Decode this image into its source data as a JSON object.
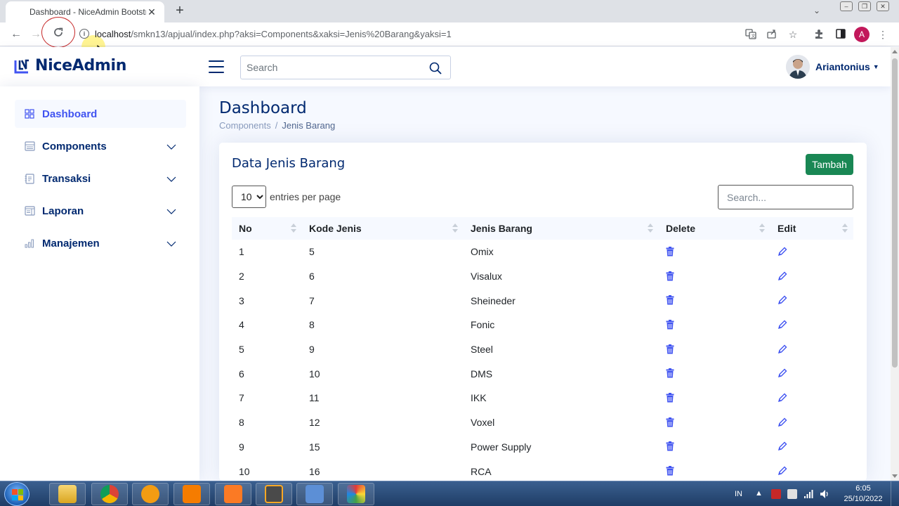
{
  "browser": {
    "tab_title": "Dashboard - NiceAdmin Bootstra",
    "url_host": "localhost",
    "url_path": "/smkn13/apjual/index.php?aksi=Components&xaksi=Jenis%20Barang&yaksi=1",
    "profile_initial": "A"
  },
  "header": {
    "logo": "NiceAdmin",
    "search_placeholder": "Search",
    "user_name": "Ariantonius"
  },
  "sidebar": {
    "items": [
      {
        "label": "Dashboard",
        "icon": "grid-icon",
        "active": true
      },
      {
        "label": "Components",
        "icon": "menu-button-icon"
      },
      {
        "label": "Transaksi",
        "icon": "journal-text-icon"
      },
      {
        "label": "Laporan",
        "icon": "layout-text-window-icon"
      },
      {
        "label": "Manajemen",
        "icon": "bar-chart-icon"
      }
    ]
  },
  "page": {
    "title": "Dashboard",
    "breadcrumb": [
      "Components",
      "Jenis Barang"
    ]
  },
  "card": {
    "title": "Data Jenis Barang",
    "add_button": "Tambah",
    "per_page_value": "10",
    "per_page_label": "entries per page",
    "search_placeholder": "Search...",
    "columns": [
      "No",
      "Kode Jenis",
      "Jenis Barang",
      "Delete",
      "Edit"
    ],
    "rows": [
      {
        "no": "1",
        "kode": "5",
        "jenis": "Omix"
      },
      {
        "no": "2",
        "kode": "6",
        "jenis": "Visalux"
      },
      {
        "no": "3",
        "kode": "7",
        "jenis": "Sheineder"
      },
      {
        "no": "4",
        "kode": "8",
        "jenis": "Fonic"
      },
      {
        "no": "5",
        "kode": "9",
        "jenis": "Steel"
      },
      {
        "no": "6",
        "kode": "10",
        "jenis": "DMS"
      },
      {
        "no": "7",
        "kode": "11",
        "jenis": "IKK"
      },
      {
        "no": "8",
        "kode": "12",
        "jenis": "Voxel"
      },
      {
        "no": "9",
        "kode": "15",
        "jenis": "Power Supply"
      },
      {
        "no": "10",
        "kode": "16",
        "jenis": "RCA"
      }
    ]
  },
  "taskbar": {
    "language": "IN",
    "time": "6:05",
    "date": "25/10/2022"
  },
  "colors": {
    "brand_navy": "#012970",
    "accent_blue": "#4154f1",
    "add_button_green": "#198754",
    "icon_blue": "#4154f1"
  }
}
